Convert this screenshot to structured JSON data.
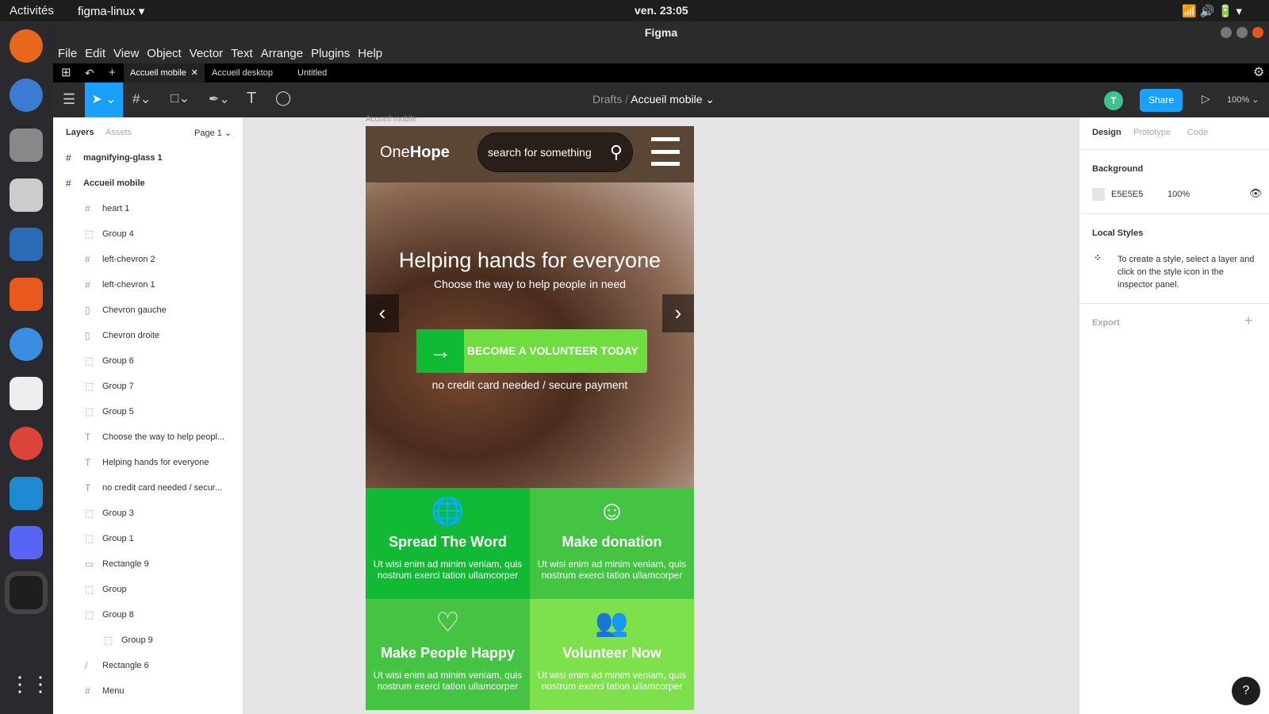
{
  "os": {
    "activities": "Activités",
    "app": "figma-linux ▾",
    "clock": "ven. 23:05"
  },
  "window": {
    "title": "Figma"
  },
  "menu": [
    "File",
    "Edit",
    "View",
    "Object",
    "Vector",
    "Text",
    "Arrange",
    "Plugins",
    "Help"
  ],
  "tabs": [
    "Accueil mobile",
    "Accueil desktop",
    "Untitled"
  ],
  "toolbar": {
    "breadcrumb_root": "Drafts",
    "breadcrumb_sep": "/",
    "file": "Accueil mobile ⌄",
    "avatar": "T",
    "share": "Share",
    "zoom": "100% ⌄"
  },
  "layers_panel": {
    "tab_layers": "Layers",
    "tab_assets": "Assets",
    "page": "Page 1 ⌄",
    "items": [
      {
        "label": "magnifying-glass 1",
        "icon": "#",
        "indent": 0,
        "bold": true
      },
      {
        "label": "Accueil mobile",
        "icon": "#",
        "indent": 0,
        "bold": true
      },
      {
        "label": "heart 1",
        "icon": "#",
        "indent": 1
      },
      {
        "label": "Group 4",
        "icon": "⬚",
        "indent": 1
      },
      {
        "label": "left-chevron 2",
        "icon": "#",
        "indent": 1
      },
      {
        "label": "left-chevron 1",
        "icon": "#",
        "indent": 1
      },
      {
        "label": "Chevron gauche",
        "icon": "▯",
        "indent": 1
      },
      {
        "label": "Chevron droite",
        "icon": "▯",
        "indent": 1
      },
      {
        "label": "Group 6",
        "icon": "⬚",
        "indent": 1
      },
      {
        "label": "Group 7",
        "icon": "⬚",
        "indent": 1
      },
      {
        "label": "Group 5",
        "icon": "⬚",
        "indent": 1
      },
      {
        "label": "Choose the way to help peopl...",
        "icon": "T",
        "indent": 1
      },
      {
        "label": "Helping hands for everyone",
        "icon": "T",
        "indent": 1
      },
      {
        "label": "no credit card needed / secur...",
        "icon": "T",
        "indent": 1
      },
      {
        "label": "Group 3",
        "icon": "⬚",
        "indent": 1
      },
      {
        "label": "Group 1",
        "icon": "⬚",
        "indent": 1
      },
      {
        "label": "Rectangle 9",
        "icon": "▭",
        "indent": 1
      },
      {
        "label": "Group",
        "icon": "⬚",
        "indent": 1
      },
      {
        "label": "Group 8",
        "icon": "⬚",
        "indent": 1
      },
      {
        "label": "Group 9",
        "icon": "⬚",
        "indent": 2
      },
      {
        "label": "Rectangle 6",
        "icon": "/",
        "indent": 1
      },
      {
        "label": "Menu",
        "icon": "#",
        "indent": 1
      }
    ]
  },
  "design_panel": {
    "tab_design": "Design",
    "tab_prototype": "Prototype",
    "tab_code": "Code",
    "background_title": "Background",
    "bg_hex": "E5E5E5",
    "bg_opacity": "100%",
    "local_styles_title": "Local Styles",
    "local_styles_hint": "To create a style, select a layer and click on the style icon in the inspector panel.",
    "export_title": "Export",
    "export_add": "+"
  },
  "canvas": {
    "frame_label": "Accueil mobile",
    "logo_one": "One",
    "logo_hope": "Hope",
    "search_placeholder": "search for something",
    "hero_title": "Helping hands for everyone",
    "hero_sub": "Choose the way to help people in need",
    "cta": "BECOME A VOLUNTEER TODAY",
    "cta_note": "no credit card needed / secure payment",
    "cards": [
      {
        "title": "Spread The Word",
        "text": "Ut wisi enim  ad minim veniam, quis nostrum exerci tation ullamcorper",
        "color": "#12b934",
        "icon": "🌐"
      },
      {
        "title": "Make donation",
        "text": "Ut wisi enim  ad minim veniam, quis nostrum exerci tation ullamcorper",
        "color": "#45c444",
        "icon": "☺"
      },
      {
        "title": "Make People Happy",
        "text": "Ut wisi enim  ad minim veniam, quis nostrum exerci tation ullamcorper",
        "color": "#45c444",
        "icon": "♡"
      },
      {
        "title": "Volunteer Now",
        "text": "Ut wisi enim  ad minim veniam, quis nostrum exerci tation ullamcorper",
        "color": "#7ee04a",
        "icon": "👥"
      }
    ]
  },
  "help": "?"
}
